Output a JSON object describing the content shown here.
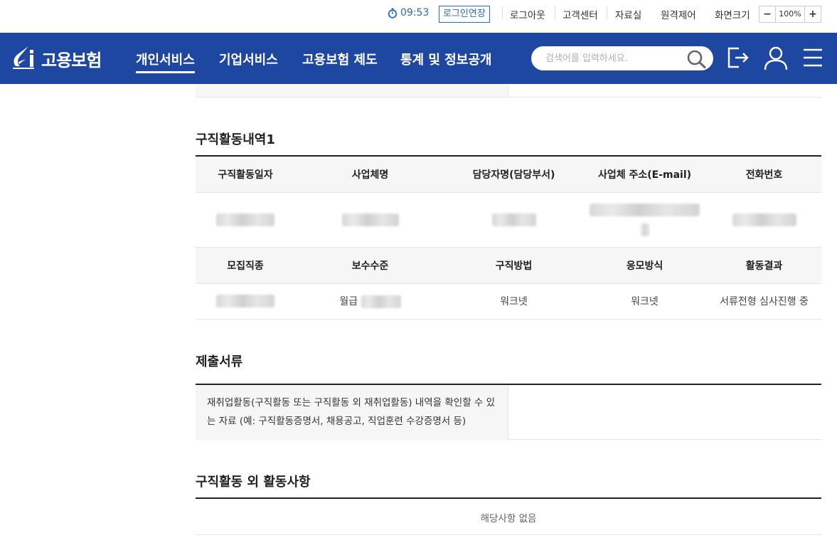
{
  "utility": {
    "timer": "09:53",
    "extend_login": "로그인연장",
    "logout": "로그아웃",
    "customer_center": "고객센터",
    "library": "자료실",
    "remote_control": "원격제어",
    "screen_size": "화면크기",
    "zoom_minus": "−",
    "zoom_value": "100%",
    "zoom_plus": "+"
  },
  "nav": {
    "logo_text": "고용보험",
    "menu": [
      "개인서비스",
      "기업서비스",
      "고용보험 제도",
      "통계 및 정보공개"
    ],
    "search_placeholder": "검색어를 입력하세요.",
    "icons": [
      "logout-icon",
      "user-icon",
      "menu-icon"
    ]
  },
  "job_activity": {
    "title": "구직활동내역1",
    "header1": [
      "구직활동일자",
      "사업체명",
      "담당자명(담당부서)",
      "사업체 주소(E-mail)",
      "전화번호"
    ],
    "header2": [
      "모집직종",
      "보수수준",
      "구직방법",
      "응모방식",
      "활동결과"
    ],
    "row2": {
      "salary_prefix": "월급",
      "method": "워크넷",
      "apply_method": "워크넷",
      "result": "서류전형 심사진행 중"
    }
  },
  "documents": {
    "title": "제출서류",
    "description": "재취업활동(구직활동 또는 구직활동 외 재취업활동) 내역을 확인할 수 있는 자료 (예: 구직활동증명서, 채용공고, 직업훈련 수강증명서 등)"
  },
  "other_activity": {
    "title": "구직활동 외 활동사항",
    "empty": "해당사항 없음"
  },
  "colors": {
    "brand": "#1d47a0",
    "accent": "#2a6bbd"
  }
}
